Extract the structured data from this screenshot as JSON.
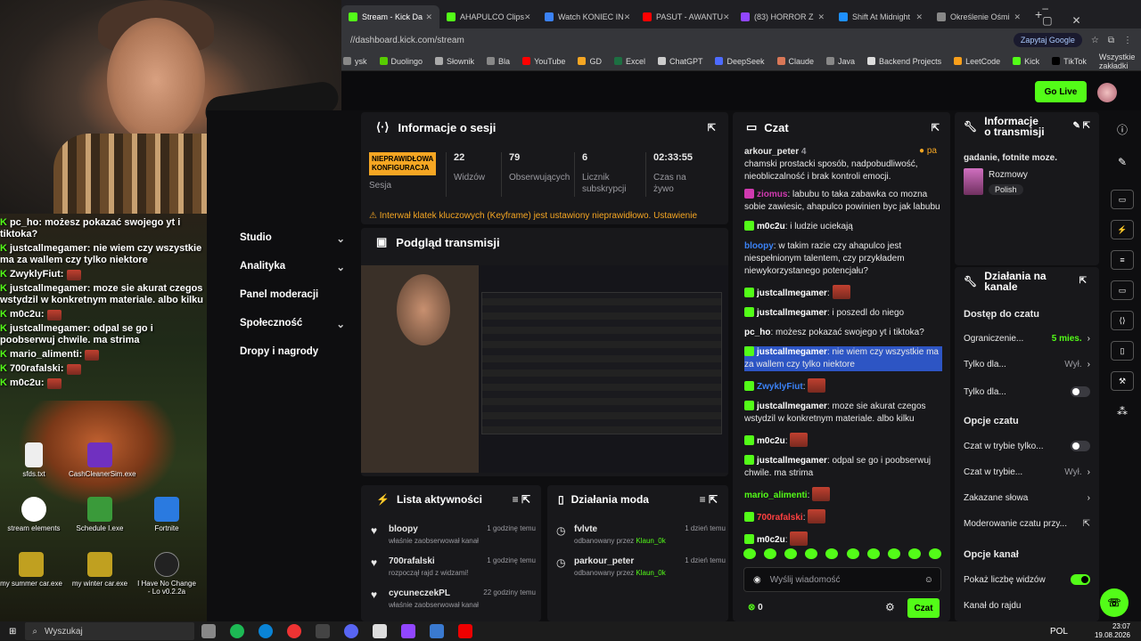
{
  "webcam_overlay": {
    "lines": [
      {
        "user": "pc_ho",
        "text": "możesz pokazać swojego yt i tiktoka?"
      },
      {
        "user": "justcallmegamer",
        "text": "nie wiem czy wszystkie ma za wallem czy tylko niektore"
      },
      {
        "user": "ZwyklyFiut",
        "text": ""
      },
      {
        "user": "justcallmegamer",
        "text": "moze sie akurat czegos wstydzil w konkretnym materiale. albo kilku"
      },
      {
        "user": "m0c2u",
        "text": ""
      },
      {
        "user": "justcallmegamer",
        "text": "odpal se go i poobserwuj chwile. ma strima"
      },
      {
        "user": "mario_alimenti",
        "text": ""
      },
      {
        "user": "700rafalski",
        "text": ""
      },
      {
        "user": "m0c2u",
        "text": ""
      }
    ]
  },
  "desktop_icons": [
    {
      "label": "sfds.txt"
    },
    {
      "label": "CashCleanerSim.exe"
    },
    {
      "label": "stream elements"
    },
    {
      "label": "Schedule I.exe"
    },
    {
      "label": "Fortnite"
    },
    {
      "label": "my summer car.exe"
    },
    {
      "label": "my winter car.exe"
    },
    {
      "label": "I Have No Change - Lo v0.2.2a"
    }
  ],
  "browser": {
    "tabs": [
      {
        "label": "Stream - Kick Da",
        "color": "#53fc18",
        "active": true
      },
      {
        "label": "AHAPULCO Clips",
        "color": "#53fc18",
        "active": false
      },
      {
        "label": "Watch KONIEC IN",
        "color": "#3b82f6",
        "active": false
      },
      {
        "label": "PASUT - AWANTU",
        "color": "#ff0000",
        "active": false
      },
      {
        "label": "(83) HORROR Z",
        "color": "#9146ff",
        "active": false
      },
      {
        "label": "Shift At Midnight",
        "color": "#1e90ff",
        "active": false
      },
      {
        "label": "Określenie Ośmi",
        "color": "#888888",
        "active": false
      }
    ],
    "url": "//dashboard.kick.com/stream",
    "ask_google": "Zapytaj Google",
    "bookmarks": [
      {
        "label": "ysk",
        "color": "#888"
      },
      {
        "label": "Duolingo",
        "color": "#58cc02"
      },
      {
        "label": "Słownik",
        "color": "#aaa"
      },
      {
        "label": "Bla",
        "color": "#888"
      },
      {
        "label": "YouTube",
        "color": "#ff0000"
      },
      {
        "label": "GD",
        "color": "#f5a623"
      },
      {
        "label": "Excel",
        "color": "#1d6f42"
      },
      {
        "label": "ChatGPT",
        "color": "#ccc"
      },
      {
        "label": "DeepSeek",
        "color": "#4d6bfe"
      },
      {
        "label": "Claude",
        "color": "#d97757"
      },
      {
        "label": "Java",
        "color": "#888"
      },
      {
        "label": "Backend Projects",
        "color": "#ddd"
      },
      {
        "label": "LeetCode",
        "color": "#f89f1b"
      },
      {
        "label": "Kick",
        "color": "#53fc18"
      },
      {
        "label": "TikTok",
        "color": "#000"
      }
    ],
    "all_bookmarks": "Wszystkie zakładki"
  },
  "header": {
    "go_live": "Go Live"
  },
  "sidenav": [
    {
      "label": "Studio"
    },
    {
      "label": "Analityka"
    },
    {
      "label": "Panel moderacji"
    },
    {
      "label": "Społeczność"
    },
    {
      "label": "Dropy i nagrody"
    }
  ],
  "session": {
    "title": "Informacje o sesji",
    "status_badge": "NIEPRAWIDŁOWA KONFIGURACJA",
    "status_label": "Sesja",
    "stats": [
      {
        "value": "22",
        "label": "Widzów"
      },
      {
        "value": "79",
        "label": "Obserwujących"
      },
      {
        "value": "6",
        "label": "Licznik subskrypcji"
      },
      {
        "value": "02:33:55",
        "label": "Czas na żywo"
      }
    ],
    "warning": "Interwał klatek kluczowych (Keyframe) jest ustawiony nieprawidłowo. Ustawienie"
  },
  "preview": {
    "title": "Podgląd transmisji"
  },
  "activity": {
    "title": "Lista aktywności",
    "items": [
      {
        "user": "bloopy",
        "desc": "właśnie zaobserwował kanał",
        "time": "1 godzinę temu"
      },
      {
        "user": "700rafalski",
        "desc": "rozpoczął rajd z widzami!",
        "time": "1 godzinę temu"
      },
      {
        "user": "cycuneczekPL",
        "desc": "właśnie zaobserwował kanał",
        "time": "22 godziny temu"
      }
    ]
  },
  "modactions": {
    "title": "Działania moda",
    "items": [
      {
        "user": "fvlvte",
        "prefix": "odbanowany przez",
        "mod": "Klaun_0k",
        "time": "1 dzień temu"
      },
      {
        "user": "parkour_peter",
        "prefix": "odbanowany przez",
        "mod": "Klaun_0k",
        "time": "1 dzień temu"
      }
    ]
  },
  "chat": {
    "title": "Czat",
    "pinned_user": "arkour_peter",
    "pinned_count": "4",
    "pinned_tail": "pa",
    "top_line": "chamski prostacki sposób, nadpobudliwość, nieobliczalność i brak kontroli emocji.",
    "messages": [
      {
        "user": "ziomus",
        "text": "labubu to taka zabawka co mozna sobie zawiesic, ahapulco powinien byc jak labubu",
        "color": "#d03ab0"
      },
      {
        "user": "m0c2u",
        "text": "i ludzie uciekają",
        "color": "#ffffff"
      },
      {
        "user": "bloopy",
        "text": "w takim razie czy ahapulco jest niespełnionym talentem, czy przykładem niewykorzystanego potencjału?",
        "color": "#3b82f6"
      },
      {
        "user": "justcallmegamer",
        "text": "",
        "color": "#ffffff"
      },
      {
        "user": "justcallmegamer",
        "text": "i poszedl do niego",
        "color": "#ffffff"
      },
      {
        "user": "pc_ho",
        "text": "możesz pokazać swojego yt i tiktoka?",
        "color": "#ffffff"
      },
      {
        "user": "justcallmegamer",
        "text": "nie wiem czy wszystkie ma za wallem czy tylko niektore",
        "color": "#ffffff"
      },
      {
        "user": "ZwyklyFiut",
        "text": "",
        "color": "#3b82f6"
      },
      {
        "user": "justcallmegamer",
        "text": "moze sie akurat czegos wstydzil w konkretnym materiale. albo kilku",
        "color": "#ffffff"
      },
      {
        "user": "m0c2u",
        "text": "",
        "color": "#ffffff"
      },
      {
        "user": "justcallmegamer",
        "text": "odpal se go i poobserwuj chwile. ma strima",
        "color": "#ffffff"
      },
      {
        "user": "mario_alimenti",
        "text": "",
        "color": "#53fc18"
      },
      {
        "user": "700rafalski",
        "text": "",
        "color": "#ff4040"
      },
      {
        "user": "m0c2u",
        "text": "",
        "color": "#ffffff"
      }
    ],
    "placeholder": "Wyślij wiadomość",
    "points": "0",
    "send": "Czat"
  },
  "stream_info": {
    "title": "Informacje o transmisji",
    "stream_title": "gadanie, fotnite moze.",
    "category": "Rozmowy",
    "language": "Polish"
  },
  "channel_actions": {
    "title": "Działania na kanale",
    "chat_access": "Dostęp do czatu",
    "restrict_label": "Ograniczenie...",
    "restrict_value": "5 mies.",
    "only_label": "Tylko dla...",
    "only_value": "Wył.",
    "only2_label": "Tylko dla...",
    "chat_options": "Opcje czatu",
    "mode1": "Czat w trybie tylko...",
    "mode2": "Czat w trybie...",
    "mode2_value": "Wył.",
    "banned_words": "Zakazane słowa",
    "moderation": "Moderowanie czatu przy...",
    "channel_options": "Opcje kanał",
    "show_viewers": "Pokaż liczbę widzów",
    "raid": "Kanał do rajdu"
  },
  "taskbar": {
    "search": "Wyszukaj",
    "lang": "POL",
    "time": "23:07",
    "date": "19.08.2026"
  }
}
